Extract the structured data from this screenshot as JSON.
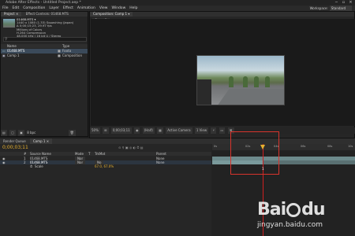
{
  "window": {
    "title": "Adobe After Effects - Untitled Project.aep *",
    "buttons": [
      "−",
      "▫",
      "×"
    ]
  },
  "menu": [
    "File",
    "Edit",
    "Composition",
    "Layer",
    "Effect",
    "Animation",
    "View",
    "Window",
    "Help"
  ],
  "workspace": {
    "label": "Workspace:",
    "value": "Standard"
  },
  "project": {
    "tabs": [
      "Project ×",
      "Effect Controls: 01468.MTS"
    ],
    "info": [
      "01468.MTS ▾",
      "1440 x 1080 (1.33) Squashing (Japan)",
      "Δ 0;00;15;23, 29.97 fps",
      "Millions of Colors",
      "H.264 Compression",
      "48.000 kHz / 16 bit U / Stereo"
    ],
    "columns": [
      "Name",
      "Type"
    ],
    "items": [
      {
        "name": "01468.MTS",
        "type": "Foota"
      },
      {
        "name": "Comp 1",
        "type": "Composition"
      }
    ],
    "bpc": "8 bpc"
  },
  "composition": {
    "tab": "Composition: Comp 1 ▾",
    "subtab": "Comp 1",
    "zoom": "50%",
    "timecode": "0;00;03;11",
    "resolution": "(Half)",
    "camera": "Active Camera",
    "views": "1 View"
  },
  "timeline": {
    "tabs": [
      "Render Queue",
      "Comp 1 ×"
    ],
    "timecode": "0;00;03;11",
    "columns": [
      "#",
      "Source Name",
      "Mode",
      "T",
      "TrkMat",
      "Parent"
    ],
    "layers": [
      {
        "num": "1",
        "name": "01468.MTS",
        "mode": "Nor",
        "trkmat": "",
        "parent": "None"
      },
      {
        "num": "2",
        "name": "01468.MTS",
        "mode": "Nor",
        "trkmat": "No",
        "parent": "None"
      }
    ],
    "property": {
      "name": "Scale",
      "value": "67.0, 67.0%"
    },
    "ruler": [
      "0s",
      "02s",
      "04s",
      "06s",
      "08s",
      "10s"
    ],
    "marker": "1"
  },
  "watermark": {
    "logo": "Bai du",
    "url": "jingyan.baidu.com"
  }
}
